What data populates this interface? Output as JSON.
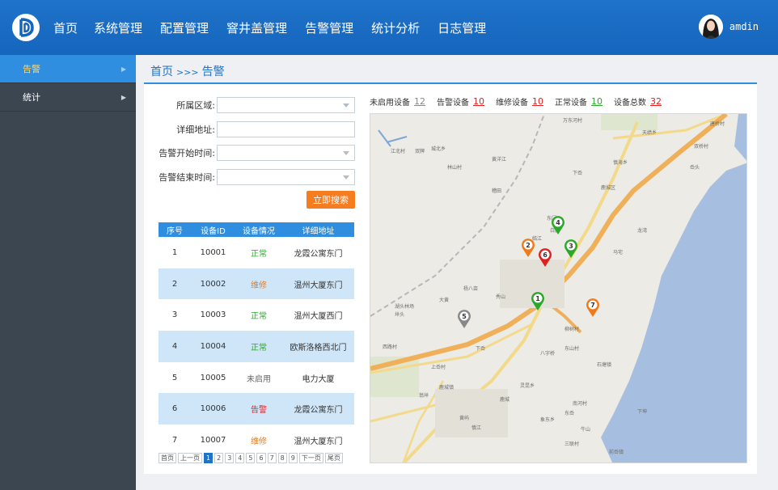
{
  "header": {
    "nav": [
      "首页",
      "系统管理",
      "配置管理",
      "窨井盖管理",
      "告警管理",
      "统计分析",
      "日志管理"
    ],
    "username": "amdin"
  },
  "sidebar": {
    "items": [
      {
        "label": "告警",
        "active": true
      },
      {
        "label": "统计",
        "active": false
      }
    ]
  },
  "breadcrumb": {
    "home": "首页",
    "sep": ">>>",
    "current": "告警"
  },
  "form": {
    "region_label": "所属区域:",
    "address_label": "详细地址:",
    "start_label": "告警开始时间:",
    "end_label": "告警结束时间:",
    "search_button": "立即搜索"
  },
  "table": {
    "headers": [
      "序号",
      "设备ID",
      "设备情况",
      "详细地址"
    ],
    "rows": [
      {
        "no": "1",
        "id": "10001",
        "status": "正常",
        "status_type": "normal",
        "address": "龙霞公寓东门"
      },
      {
        "no": "2",
        "id": "10002",
        "status": "维修",
        "status_type": "repair",
        "address": "温州大厦东门"
      },
      {
        "no": "3",
        "id": "10003",
        "status": "正常",
        "status_type": "normal",
        "address": "温州大厦西门"
      },
      {
        "no": "4",
        "id": "10004",
        "status": "正常",
        "status_type": "normal",
        "address": "欧斯洛格西北门"
      },
      {
        "no": "5",
        "id": "10005",
        "status": "未启用",
        "status_type": "unused",
        "address": "电力大厦"
      },
      {
        "no": "6",
        "id": "10006",
        "status": "告警",
        "status_type": "alarm",
        "address": "龙霞公寓东门"
      },
      {
        "no": "7",
        "id": "10007",
        "status": "维修",
        "status_type": "repair",
        "address": "温州大厦东门"
      }
    ]
  },
  "pager": {
    "first": "首页",
    "prev": "上一页",
    "pages": [
      "1",
      "2",
      "3",
      "4",
      "5",
      "6",
      "7",
      "8",
      "9"
    ],
    "current": "1",
    "next": "下一页",
    "last": "尾页"
  },
  "stats": [
    {
      "label": "未启用设备",
      "value": "12",
      "color": "#888888"
    },
    {
      "label": "告警设备",
      "value": "10",
      "color": "#e02020"
    },
    {
      "label": "维修设备",
      "value": "10",
      "color": "#e02020"
    },
    {
      "label": "正常设备",
      "value": "10",
      "color": "#2aa82a"
    },
    {
      "label": "设备总数",
      "value": "32",
      "color": "#e02020"
    }
  ],
  "map": {
    "markers": [
      {
        "num": "1",
        "color": "#2aa82a"
      },
      {
        "num": "2",
        "color": "#f07a1a"
      },
      {
        "num": "3",
        "color": "#2aa82a"
      },
      {
        "num": "4",
        "color": "#2aa82a"
      },
      {
        "num": "5",
        "color": "#888888"
      },
      {
        "num": "6",
        "color": "#e02020"
      },
      {
        "num": "7",
        "color": "#f07a1a"
      }
    ],
    "labels": [
      "万东河村",
      "天绩乡",
      "唐桥村",
      "双桥村",
      "城北乡",
      "林山村",
      "黄洋江",
      "慎海乡",
      "岙头",
      "下岙",
      "稽田",
      "鹿城区",
      "东门",
      "白鹿",
      "龙湾",
      "临江",
      "马宅",
      "江北村",
      "双牌",
      "湖头林场",
      "大黄",
      "杨八亩",
      "垟头",
      "西路村",
      "下岙",
      "上岙村",
      "鹿城",
      "翁垟",
      "慎江",
      "东岙",
      "东山村",
      "柳树村",
      "黄屿",
      "牛山",
      "鹿城镇",
      "灵昆乡",
      "象东乡",
      "南河村",
      "前岙镇",
      "下坤",
      "三联村",
      "石塘镇",
      "秀山",
      "八字桥"
    ]
  }
}
